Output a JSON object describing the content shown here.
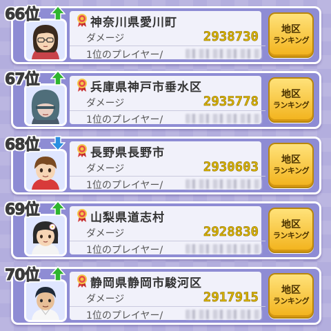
{
  "rows": [
    {
      "rank": "66位",
      "trend": "up",
      "area": "神奈川県愛川町",
      "damage_label": "ダメージ",
      "damage": "2938730",
      "player_label": "1位のプレイヤー/",
      "button_line1": "地区",
      "button_line2": "ランキング"
    },
    {
      "rank": "67位",
      "trend": "up",
      "area": "兵庫県神戸市垂水区",
      "damage_label": "ダメージ",
      "damage": "2935778",
      "player_label": "1位のプレイヤー/",
      "button_line1": "地区",
      "button_line2": "ランキング"
    },
    {
      "rank": "68位",
      "trend": "down",
      "area": "長野県長野市",
      "damage_label": "ダメージ",
      "damage": "2930603",
      "player_label": "1位のプレイヤー/",
      "button_line1": "地区",
      "button_line2": "ランキング"
    },
    {
      "rank": "69位",
      "trend": "up",
      "area": "山梨県道志村",
      "damage_label": "ダメージ",
      "damage": "2928830",
      "player_label": "1位のプレイヤー/",
      "button_line1": "地区",
      "button_line2": "ランキング"
    },
    {
      "rank": "70位",
      "trend": "up",
      "area": "静岡県静岡市駿河区",
      "damage_label": "ダメージ",
      "damage": "2917915",
      "player_label": "1位のプレイヤー/",
      "button_line1": "地区",
      "button_line2": "ランキング"
    }
  ],
  "colors": {
    "up_arrow": "#2fb52f",
    "down_arrow": "#2a8fe0",
    "damage_text": "#d9b300",
    "button": "#f2b21b",
    "panel": "#8e8cd4",
    "background": "#b3aede"
  },
  "icons": {
    "up": "green-up-arrow-icon",
    "down": "blue-down-arrow-icon",
    "ribbon": "award-ribbon-icon"
  }
}
